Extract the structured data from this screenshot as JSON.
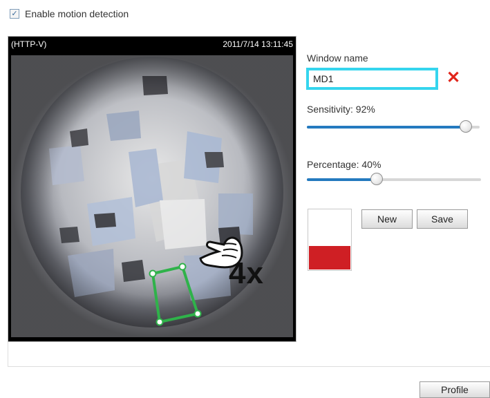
{
  "header": {
    "checkbox_label": "Enable motion detection",
    "checkbox_checked": true
  },
  "camera": {
    "stream_label": "(HTTP-V)",
    "timestamp": "2011/7/14 13:11:45"
  },
  "settings": {
    "window_name_label": "Window name",
    "window_name_value": "MD1",
    "sensitivity_label": "Sensitivity: 92%",
    "sensitivity_value": 92,
    "percentage_label": "Percentage: 40%",
    "percentage_value": 40,
    "new_button": "New",
    "save_button": "Save",
    "preview_level": 0.4
  },
  "footer": {
    "profile_button": "Profile"
  },
  "annotation": {
    "multiplier": "4x"
  },
  "colors": {
    "accent": "#247abf",
    "input_highlight": "#35d5ee",
    "delete": "#e1251b",
    "preview_fill": "#cf1f24",
    "motion_window": "#2fb24a"
  }
}
